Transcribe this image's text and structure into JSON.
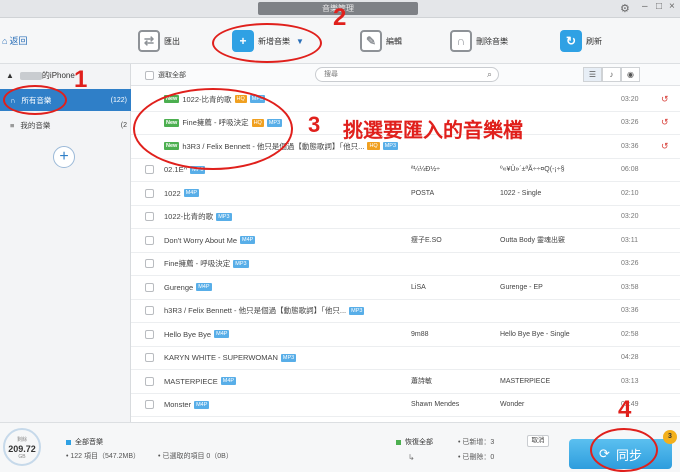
{
  "window": {
    "title": "音樂管理"
  },
  "toolbar": {
    "back_label": "返回",
    "export_label": "匯出",
    "add_label": "新增音樂",
    "edit_label": "編輯",
    "delete_label": "刪除音樂",
    "refresh_label": "刷新"
  },
  "sidebar": {
    "device": "的iPhone",
    "items": [
      {
        "label": "所有音樂",
        "count": "(122)"
      },
      {
        "label": "我的音樂",
        "count": "(2"
      }
    ],
    "add_symbol": "+"
  },
  "list": {
    "select_all": "選取全部",
    "search_placeholder": "搜尋",
    "rows": [
      {
        "title": "1022-比青的歌",
        "new": "New",
        "fmt": [
          "HQ",
          "MP3"
        ],
        "artist": "",
        "album": "",
        "duration": "03:20",
        "pending": true
      },
      {
        "title": "Fine擁薦 - 呼吸決定",
        "new": "New",
        "fmt": [
          "HQ",
          "MP3"
        ],
        "artist": "",
        "album": "",
        "duration": "03:26",
        "pending": true
      },
      {
        "title": "h3R3 / Felix Bennett - 他只是個過【動態歌詞】「他只...",
        "new": "New",
        "fmt": [
          "HQ",
          "MP3"
        ],
        "artist": "",
        "album": "",
        "duration": "03:36",
        "pending": true
      },
      {
        "title": "02.1E^",
        "new": "",
        "fmt": [
          "MP3"
        ],
        "artist": "ª¼¼Ð½÷",
        "album": "º«¥Û»´±ªÃ÷÷¤Q(-¡÷§",
        "duration": "06:08",
        "pending": false
      },
      {
        "title": "1022",
        "new": "",
        "fmt": [
          "M4P"
        ],
        "artist": "POSTA",
        "album": "1022 - Single",
        "duration": "02:10",
        "pending": false
      },
      {
        "title": "1022-比青的歌",
        "new": "",
        "fmt": [
          "MP3"
        ],
        "artist": "",
        "album": "",
        "duration": "03:20",
        "pending": false
      },
      {
        "title": "Don't Worry About Me",
        "new": "",
        "fmt": [
          "M4P"
        ],
        "artist": "瘦子E.SO",
        "album": "Outta Body 靈魂出竅",
        "duration": "03:11",
        "pending": false
      },
      {
        "title": "Fine擁薦 - 呼吸決定",
        "new": "",
        "fmt": [
          "MP3"
        ],
        "artist": "",
        "album": "",
        "duration": "03:26",
        "pending": false
      },
      {
        "title": "Gurenge",
        "new": "",
        "fmt": [
          "M4P"
        ],
        "artist": "LiSA",
        "album": "Gurenge - EP",
        "duration": "03:58",
        "pending": false
      },
      {
        "title": "h3R3 / Felix Bennett - 他只是個過【動態歌詞】「他只...",
        "new": "",
        "fmt": [
          "MP3"
        ],
        "artist": "",
        "album": "",
        "duration": "03:36",
        "pending": false
      },
      {
        "title": "Hello Bye Bye",
        "new": "",
        "fmt": [
          "M4P"
        ],
        "artist": "9m88",
        "album": "Hello Bye Bye - Single",
        "duration": "02:58",
        "pending": false
      },
      {
        "title": "KARYN WHITE - SUPERWOMAN",
        "new": "",
        "fmt": [
          "MP3"
        ],
        "artist": "",
        "album": "",
        "duration": "04:28",
        "pending": false
      },
      {
        "title": "MASTERPIECE",
        "new": "",
        "fmt": [
          "M4P"
        ],
        "artist": "蕭詩敏",
        "album": "MASTERPIECE",
        "duration": "03:13",
        "pending": false
      },
      {
        "title": "Monster",
        "new": "",
        "fmt": [
          "M4P"
        ],
        "artist": "Shawn Mendes",
        "album": "Wonder",
        "duration": "02:49",
        "pending": false
      }
    ]
  },
  "footer": {
    "storage_caption": "剩餘",
    "storage_value": "209.72",
    "storage_unit": "GB",
    "all_music_label": "全部音樂",
    "items_summary": "• 122 項目（547.2MB）",
    "selected_summary": "• 已選取的項目 0（0B）",
    "restore_all_label": "恢復全部",
    "added_label": "• 已新增：3",
    "removed_label": "• 已刪除：0",
    "cancel_label": "取消",
    "sync_label": "同步",
    "sync_badge": "3"
  },
  "annotations": {
    "n1": "1",
    "n2": "2",
    "n3": "3",
    "n3_text": "挑選要匯入的音樂檔",
    "n4": "4"
  },
  "colors": {
    "accent": "#2f7fc8",
    "annotation": "#e0201c",
    "new_badge": "#4caf50",
    "hq_badge": "#f0a020",
    "format_badge": "#58aee8"
  }
}
